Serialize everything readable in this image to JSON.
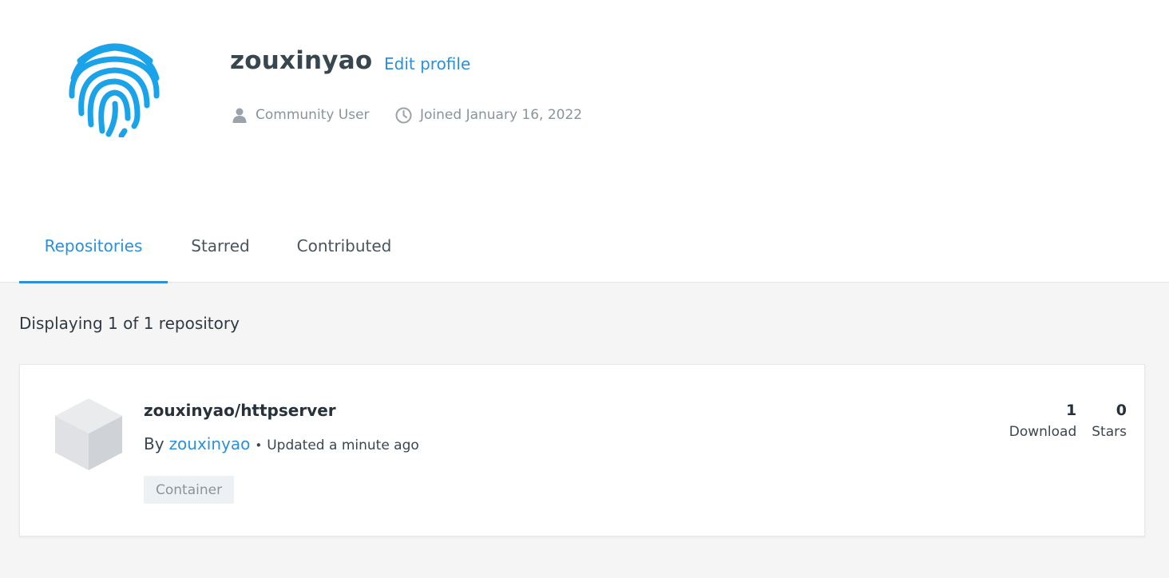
{
  "profile": {
    "username": "zouxinyao",
    "edit_label": "Edit profile",
    "role": "Community User",
    "joined": "Joined January 16, 2022",
    "avatar_icon": "fingerprint-icon",
    "accent_color": "#2c8fd9"
  },
  "tabs": [
    {
      "label": "Repositories",
      "active": true
    },
    {
      "label": "Starred",
      "active": false
    },
    {
      "label": "Contributed",
      "active": false
    }
  ],
  "listing": {
    "summary": "Displaying 1 of 1 repository",
    "repositories": [
      {
        "name": "zouxinyao/httpserver",
        "by_label": "By",
        "owner": "zouxinyao",
        "separator": "•",
        "updated": "Updated a minute ago",
        "badge": "Container",
        "icon": "cube-icon",
        "downloads": "1",
        "downloads_label": "Download",
        "stars": "0",
        "stars_label": "Stars"
      }
    ]
  }
}
